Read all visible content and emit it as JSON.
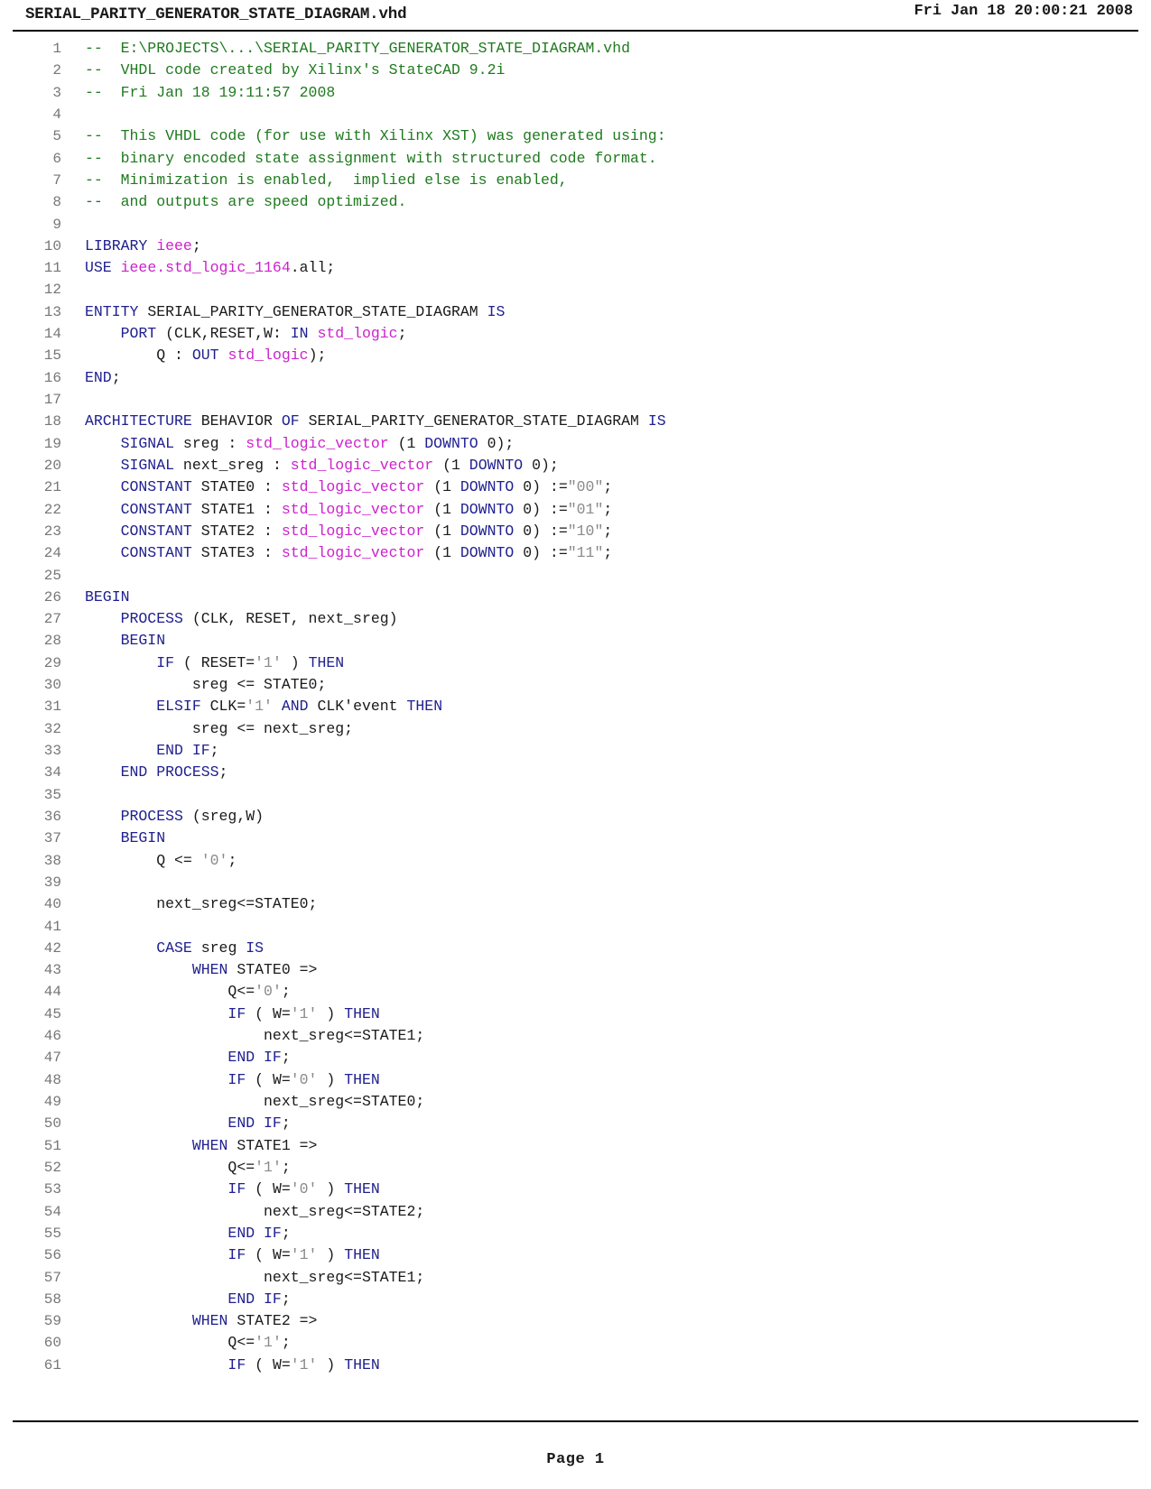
{
  "header": {
    "title": "SERIAL_PARITY_GENERATOR_STATE_DIAGRAM.vhd",
    "timestamp": "Fri Jan 18 20:00:21 2008"
  },
  "footer": {
    "page_label": "Page 1"
  },
  "colors": {
    "comment": "#1f7a1f",
    "keyword": "#202090",
    "identifier": "#cc22cc",
    "literal": "#8a8a8a",
    "plain": "#1a1a1a",
    "line_number": "#767676",
    "rule": "#000000",
    "background": "#ffffff"
  },
  "listing": {
    "first_line": 1,
    "last_line": 61,
    "language": "VHDL",
    "lines": [
      {
        "n": "1",
        "tokens": [
          {
            "t": "com",
            "s": "--  E:\\PROJECTS\\...\\SERIAL_PARITY_GENERATOR_STATE_DIAGRAM.vhd"
          }
        ]
      },
      {
        "n": "2",
        "tokens": [
          {
            "t": "com",
            "s": "--  VHDL code created by Xilinx's StateCAD 9.2i"
          }
        ]
      },
      {
        "n": "3",
        "tokens": [
          {
            "t": "com",
            "s": "--  Fri Jan 18 19:11:57 2008"
          }
        ]
      },
      {
        "n": "4",
        "tokens": []
      },
      {
        "n": "5",
        "tokens": [
          {
            "t": "com",
            "s": "--  This VHDL code (for use with Xilinx XST) was generated using:"
          }
        ]
      },
      {
        "n": "6",
        "tokens": [
          {
            "t": "com",
            "s": "--  binary encoded state assignment with structured code format."
          }
        ]
      },
      {
        "n": "7",
        "tokens": [
          {
            "t": "com",
            "s": "--  Minimization is enabled,  implied else is enabled,"
          }
        ]
      },
      {
        "n": "8",
        "tokens": [
          {
            "t": "com",
            "s": "--  and outputs are speed optimized."
          }
        ]
      },
      {
        "n": "9",
        "tokens": []
      },
      {
        "n": "10",
        "tokens": [
          {
            "t": "kw",
            "s": "LIBRARY "
          },
          {
            "t": "id",
            "s": "ieee"
          },
          {
            "t": "txt",
            "s": ";"
          }
        ]
      },
      {
        "n": "11",
        "tokens": [
          {
            "t": "kw",
            "s": "USE "
          },
          {
            "t": "id",
            "s": "ieee.std_logic_1164"
          },
          {
            "t": "txt",
            "s": ".all;"
          }
        ]
      },
      {
        "n": "12",
        "tokens": []
      },
      {
        "n": "13",
        "tokens": [
          {
            "t": "kw",
            "s": "ENTITY "
          },
          {
            "t": "txt",
            "s": "SERIAL_PARITY_GENERATOR_STATE_DIAGRAM "
          },
          {
            "t": "kw",
            "s": "IS"
          }
        ]
      },
      {
        "n": "14",
        "tokens": [
          {
            "t": "kw",
            "s": "    PORT "
          },
          {
            "t": "txt",
            "s": "(CLK,RESET,W: "
          },
          {
            "t": "kw",
            "s": "IN "
          },
          {
            "t": "id",
            "s": "std_logic"
          },
          {
            "t": "txt",
            "s": ";"
          }
        ]
      },
      {
        "n": "15",
        "tokens": [
          {
            "t": "txt",
            "s": "        Q : "
          },
          {
            "t": "kw",
            "s": "OUT "
          },
          {
            "t": "id",
            "s": "std_logic"
          },
          {
            "t": "txt",
            "s": ");"
          }
        ]
      },
      {
        "n": "16",
        "tokens": [
          {
            "t": "kw",
            "s": "END"
          },
          {
            "t": "txt",
            "s": ";"
          }
        ]
      },
      {
        "n": "17",
        "tokens": []
      },
      {
        "n": "18",
        "tokens": [
          {
            "t": "kw",
            "s": "ARCHITECTURE "
          },
          {
            "t": "txt",
            "s": "BEHAVIOR "
          },
          {
            "t": "kw",
            "s": "OF "
          },
          {
            "t": "txt",
            "s": "SERIAL_PARITY_GENERATOR_STATE_DIAGRAM "
          },
          {
            "t": "kw",
            "s": "IS"
          }
        ]
      },
      {
        "n": "19",
        "tokens": [
          {
            "t": "kw",
            "s": "    SIGNAL "
          },
          {
            "t": "txt",
            "s": "sreg : "
          },
          {
            "t": "id",
            "s": "std_logic_vector"
          },
          {
            "t": "txt",
            "s": " (1 "
          },
          {
            "t": "kw",
            "s": "DOWNTO"
          },
          {
            "t": "txt",
            "s": " 0);"
          }
        ]
      },
      {
        "n": "20",
        "tokens": [
          {
            "t": "kw",
            "s": "    SIGNAL "
          },
          {
            "t": "txt",
            "s": "next_sreg : "
          },
          {
            "t": "id",
            "s": "std_logic_vector"
          },
          {
            "t": "txt",
            "s": " (1 "
          },
          {
            "t": "kw",
            "s": "DOWNTO"
          },
          {
            "t": "txt",
            "s": " 0);"
          }
        ]
      },
      {
        "n": "21",
        "tokens": [
          {
            "t": "kw",
            "s": "    CONSTANT "
          },
          {
            "t": "txt",
            "s": "STATE0 : "
          },
          {
            "t": "id",
            "s": "std_logic_vector"
          },
          {
            "t": "txt",
            "s": " (1 "
          },
          {
            "t": "kw",
            "s": "DOWNTO"
          },
          {
            "t": "txt",
            "s": " 0) :="
          },
          {
            "t": "lit",
            "s": "\"00\""
          },
          {
            "t": "txt",
            "s": ";"
          }
        ]
      },
      {
        "n": "22",
        "tokens": [
          {
            "t": "kw",
            "s": "    CONSTANT "
          },
          {
            "t": "txt",
            "s": "STATE1 : "
          },
          {
            "t": "id",
            "s": "std_logic_vector"
          },
          {
            "t": "txt",
            "s": " (1 "
          },
          {
            "t": "kw",
            "s": "DOWNTO"
          },
          {
            "t": "txt",
            "s": " 0) :="
          },
          {
            "t": "lit",
            "s": "\"01\""
          },
          {
            "t": "txt",
            "s": ";"
          }
        ]
      },
      {
        "n": "23",
        "tokens": [
          {
            "t": "kw",
            "s": "    CONSTANT "
          },
          {
            "t": "txt",
            "s": "STATE2 : "
          },
          {
            "t": "id",
            "s": "std_logic_vector"
          },
          {
            "t": "txt",
            "s": " (1 "
          },
          {
            "t": "kw",
            "s": "DOWNTO"
          },
          {
            "t": "txt",
            "s": " 0) :="
          },
          {
            "t": "lit",
            "s": "\"10\""
          },
          {
            "t": "txt",
            "s": ";"
          }
        ]
      },
      {
        "n": "24",
        "tokens": [
          {
            "t": "kw",
            "s": "    CONSTANT "
          },
          {
            "t": "txt",
            "s": "STATE3 : "
          },
          {
            "t": "id",
            "s": "std_logic_vector"
          },
          {
            "t": "txt",
            "s": " (1 "
          },
          {
            "t": "kw",
            "s": "DOWNTO"
          },
          {
            "t": "txt",
            "s": " 0) :="
          },
          {
            "t": "lit",
            "s": "\"11\""
          },
          {
            "t": "txt",
            "s": ";"
          }
        ]
      },
      {
        "n": "25",
        "tokens": []
      },
      {
        "n": "26",
        "tokens": [
          {
            "t": "kw",
            "s": "BEGIN"
          }
        ]
      },
      {
        "n": "27",
        "tokens": [
          {
            "t": "kw",
            "s": "    PROCESS "
          },
          {
            "t": "txt",
            "s": "(CLK, RESET, next_sreg)"
          }
        ]
      },
      {
        "n": "28",
        "tokens": [
          {
            "t": "kw",
            "s": "    BEGIN"
          }
        ]
      },
      {
        "n": "29",
        "tokens": [
          {
            "t": "kw",
            "s": "        IF "
          },
          {
            "t": "txt",
            "s": "( RESET="
          },
          {
            "t": "lit",
            "s": "'1'"
          },
          {
            "t": "txt",
            "s": " ) "
          },
          {
            "t": "kw",
            "s": "THEN"
          }
        ]
      },
      {
        "n": "30",
        "tokens": [
          {
            "t": "txt",
            "s": "            sreg <= STATE0;"
          }
        ]
      },
      {
        "n": "31",
        "tokens": [
          {
            "t": "kw",
            "s": "        ELSIF "
          },
          {
            "t": "txt",
            "s": "CLK="
          },
          {
            "t": "lit",
            "s": "'1'"
          },
          {
            "t": "txt",
            "s": " "
          },
          {
            "t": "kw",
            "s": "AND "
          },
          {
            "t": "txt",
            "s": "CLK'event "
          },
          {
            "t": "kw",
            "s": "THEN"
          }
        ]
      },
      {
        "n": "32",
        "tokens": [
          {
            "t": "txt",
            "s": "            sreg <= next_sreg;"
          }
        ]
      },
      {
        "n": "33",
        "tokens": [
          {
            "t": "kw",
            "s": "        END IF"
          },
          {
            "t": "txt",
            "s": ";"
          }
        ]
      },
      {
        "n": "34",
        "tokens": [
          {
            "t": "kw",
            "s": "    END PROCESS"
          },
          {
            "t": "txt",
            "s": ";"
          }
        ]
      },
      {
        "n": "35",
        "tokens": []
      },
      {
        "n": "36",
        "tokens": [
          {
            "t": "kw",
            "s": "    PROCESS "
          },
          {
            "t": "txt",
            "s": "(sreg,W)"
          }
        ]
      },
      {
        "n": "37",
        "tokens": [
          {
            "t": "kw",
            "s": "    BEGIN"
          }
        ]
      },
      {
        "n": "38",
        "tokens": [
          {
            "t": "txt",
            "s": "        Q <= "
          },
          {
            "t": "lit",
            "s": "'0'"
          },
          {
            "t": "txt",
            "s": ";"
          }
        ]
      },
      {
        "n": "39",
        "tokens": []
      },
      {
        "n": "40",
        "tokens": [
          {
            "t": "txt",
            "s": "        next_sreg<=STATE0;"
          }
        ]
      },
      {
        "n": "41",
        "tokens": []
      },
      {
        "n": "42",
        "tokens": [
          {
            "t": "kw",
            "s": "        CASE "
          },
          {
            "t": "txt",
            "s": "sreg "
          },
          {
            "t": "kw",
            "s": "IS"
          }
        ]
      },
      {
        "n": "43",
        "tokens": [
          {
            "t": "kw",
            "s": "            WHEN "
          },
          {
            "t": "txt",
            "s": "STATE0 =>"
          }
        ]
      },
      {
        "n": "44",
        "tokens": [
          {
            "t": "txt",
            "s": "                Q<="
          },
          {
            "t": "lit",
            "s": "'0'"
          },
          {
            "t": "txt",
            "s": ";"
          }
        ]
      },
      {
        "n": "45",
        "tokens": [
          {
            "t": "kw",
            "s": "                IF "
          },
          {
            "t": "txt",
            "s": "( W="
          },
          {
            "t": "lit",
            "s": "'1'"
          },
          {
            "t": "txt",
            "s": " ) "
          },
          {
            "t": "kw",
            "s": "THEN"
          }
        ]
      },
      {
        "n": "46",
        "tokens": [
          {
            "t": "txt",
            "s": "                    next_sreg<=STATE1;"
          }
        ]
      },
      {
        "n": "47",
        "tokens": [
          {
            "t": "kw",
            "s": "                END IF"
          },
          {
            "t": "txt",
            "s": ";"
          }
        ]
      },
      {
        "n": "48",
        "tokens": [
          {
            "t": "kw",
            "s": "                IF "
          },
          {
            "t": "txt",
            "s": "( W="
          },
          {
            "t": "lit",
            "s": "'0'"
          },
          {
            "t": "txt",
            "s": " ) "
          },
          {
            "t": "kw",
            "s": "THEN"
          }
        ]
      },
      {
        "n": "49",
        "tokens": [
          {
            "t": "txt",
            "s": "                    next_sreg<=STATE0;"
          }
        ]
      },
      {
        "n": "50",
        "tokens": [
          {
            "t": "kw",
            "s": "                END IF"
          },
          {
            "t": "txt",
            "s": ";"
          }
        ]
      },
      {
        "n": "51",
        "tokens": [
          {
            "t": "kw",
            "s": "            WHEN "
          },
          {
            "t": "txt",
            "s": "STATE1 =>"
          }
        ]
      },
      {
        "n": "52",
        "tokens": [
          {
            "t": "txt",
            "s": "                Q<="
          },
          {
            "t": "lit",
            "s": "'1'"
          },
          {
            "t": "txt",
            "s": ";"
          }
        ]
      },
      {
        "n": "53",
        "tokens": [
          {
            "t": "kw",
            "s": "                IF "
          },
          {
            "t": "txt",
            "s": "( W="
          },
          {
            "t": "lit",
            "s": "'0'"
          },
          {
            "t": "txt",
            "s": " ) "
          },
          {
            "t": "kw",
            "s": "THEN"
          }
        ]
      },
      {
        "n": "54",
        "tokens": [
          {
            "t": "txt",
            "s": "                    next_sreg<=STATE2;"
          }
        ]
      },
      {
        "n": "55",
        "tokens": [
          {
            "t": "kw",
            "s": "                END IF"
          },
          {
            "t": "txt",
            "s": ";"
          }
        ]
      },
      {
        "n": "56",
        "tokens": [
          {
            "t": "kw",
            "s": "                IF "
          },
          {
            "t": "txt",
            "s": "( W="
          },
          {
            "t": "lit",
            "s": "'1'"
          },
          {
            "t": "txt",
            "s": " ) "
          },
          {
            "t": "kw",
            "s": "THEN"
          }
        ]
      },
      {
        "n": "57",
        "tokens": [
          {
            "t": "txt",
            "s": "                    next_sreg<=STATE1;"
          }
        ]
      },
      {
        "n": "58",
        "tokens": [
          {
            "t": "kw",
            "s": "                END IF"
          },
          {
            "t": "txt",
            "s": ";"
          }
        ]
      },
      {
        "n": "59",
        "tokens": [
          {
            "t": "kw",
            "s": "            WHEN "
          },
          {
            "t": "txt",
            "s": "STATE2 =>"
          }
        ]
      },
      {
        "n": "60",
        "tokens": [
          {
            "t": "txt",
            "s": "                Q<="
          },
          {
            "t": "lit",
            "s": "'1'"
          },
          {
            "t": "txt",
            "s": ";"
          }
        ]
      },
      {
        "n": "61",
        "tokens": [
          {
            "t": "kw",
            "s": "                IF "
          },
          {
            "t": "txt",
            "s": "( W="
          },
          {
            "t": "lit",
            "s": "'1'"
          },
          {
            "t": "txt",
            "s": " ) "
          },
          {
            "t": "kw",
            "s": "THEN"
          }
        ]
      }
    ]
  }
}
